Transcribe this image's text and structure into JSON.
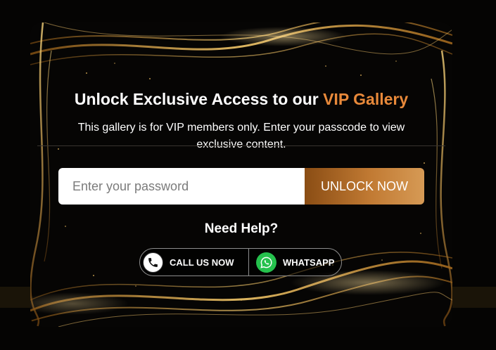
{
  "modal": {
    "title_prefix": "Unlock Exclusive Access to our ",
    "title_highlight": "VIP Gallery",
    "subtitle": "This gallery is for VIP members only. Enter your passcode to view exclusive content."
  },
  "form": {
    "password_placeholder": "Enter your password",
    "password_value": "",
    "unlock_label": "UNLOCK NOW"
  },
  "help": {
    "heading": "Need Help?",
    "call_label": "CALL US NOW",
    "whatsapp_label": "WHATSAPP"
  },
  "icons": {
    "call": "phone-icon",
    "whatsapp": "whatsapp-icon"
  },
  "colors": {
    "accent": "#e8893a",
    "button_gradient_start": "#8a4d14",
    "button_gradient_end": "#d69a55",
    "whatsapp_green": "#25c14d",
    "gold_decor": "#d9a441"
  }
}
